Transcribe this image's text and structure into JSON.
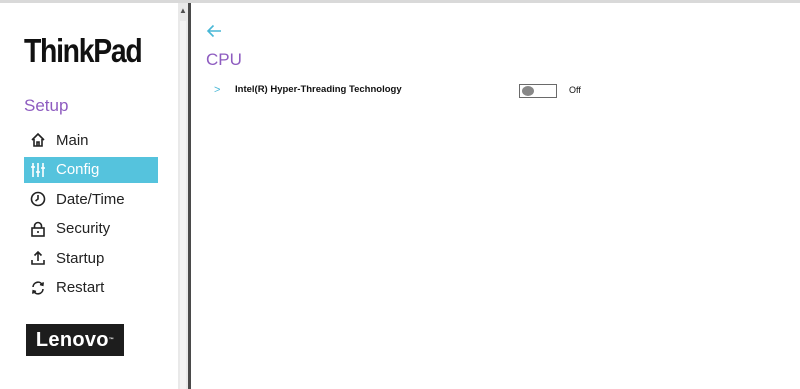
{
  "sidebar": {
    "brand": "ThinkPad",
    "section_title": "Setup",
    "items": [
      {
        "label": "Main",
        "icon": "home-icon",
        "active": false
      },
      {
        "label": "Config",
        "icon": "sliders-icon",
        "active": true
      },
      {
        "label": "Date/Time",
        "icon": "clock-icon",
        "active": false
      },
      {
        "label": "Security",
        "icon": "lock-icon",
        "active": false
      },
      {
        "label": "Startup",
        "icon": "upload-icon",
        "active": false
      },
      {
        "label": "Restart",
        "icon": "restart-icon",
        "active": false
      }
    ],
    "vendor_logo": "Lenovo"
  },
  "main": {
    "back_icon": "arrow-left-icon",
    "title": "CPU",
    "settings": [
      {
        "label": "Intel(R) Hyper-Threading Technology",
        "state": "Off",
        "enabled": false
      }
    ]
  },
  "colors": {
    "accent": "#55c3dd",
    "title": "#8e5cc0"
  }
}
